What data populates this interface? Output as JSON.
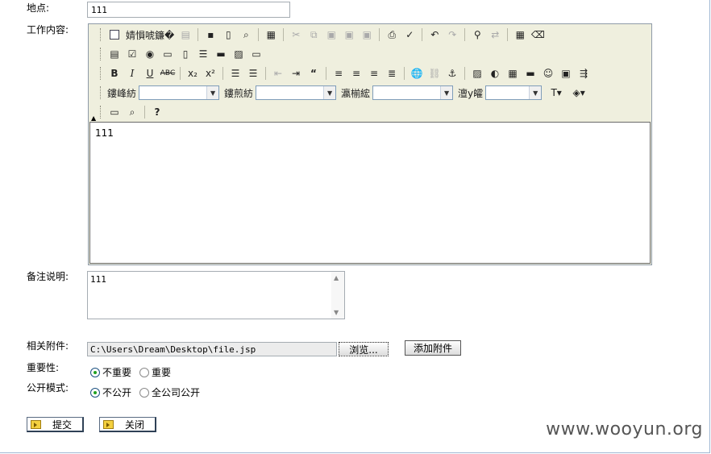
{
  "form": {
    "location_label": "地点:",
    "location_value": "111",
    "content_label": "工作内容:",
    "content_value": "111",
    "remark_label": "备注说明:",
    "remark_value": "111",
    "attachment_label": "相关附件:",
    "attachment_value": "C:\\Users\\Dream\\Desktop\\file.jsp",
    "browse_label": "浏览...",
    "add_attachment_label": "添加附件",
    "importance_label": "重要性:",
    "importance_options": [
      "不重要",
      "重要"
    ],
    "importance_selected": "不重要",
    "public_label": "公开模式:",
    "public_options": [
      "不公开",
      "全公司公开"
    ],
    "public_selected": "不公开"
  },
  "toolbar": {
    "source_label": "婧愪唬鐮�",
    "font_label": "鏤峰紡",
    "format_label": "鏤煎紡",
    "fontname_label": "瀛椾綋",
    "fontsize_label": "澶у皬"
  },
  "actions": {
    "submit_label": "提交",
    "close_label": "关闭"
  },
  "watermark": "www.wooyun.org"
}
